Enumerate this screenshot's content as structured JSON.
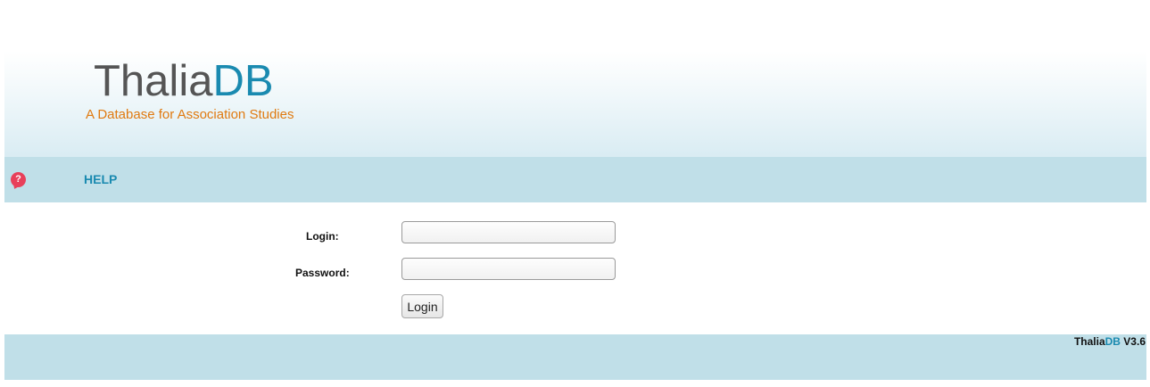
{
  "header": {
    "logo_part1": "Thalia",
    "logo_part2": "DB",
    "tagline": "A Database for Association Studies"
  },
  "nav": {
    "help_icon": "question-bubble-icon",
    "help_label": "HELP"
  },
  "form": {
    "login_label": "Login:",
    "login_value": "",
    "password_label": "Password:",
    "password_value": "",
    "submit_label": "Login"
  },
  "footer": {
    "brand_part1": "Thalia",
    "brand_part2": "DB",
    "version": " V3.6"
  },
  "colors": {
    "accent_blue": "#1a8ab0",
    "tagline_orange": "#e07a10",
    "bar_blue": "#c0dfe8",
    "help_icon_red": "#e8405a"
  }
}
